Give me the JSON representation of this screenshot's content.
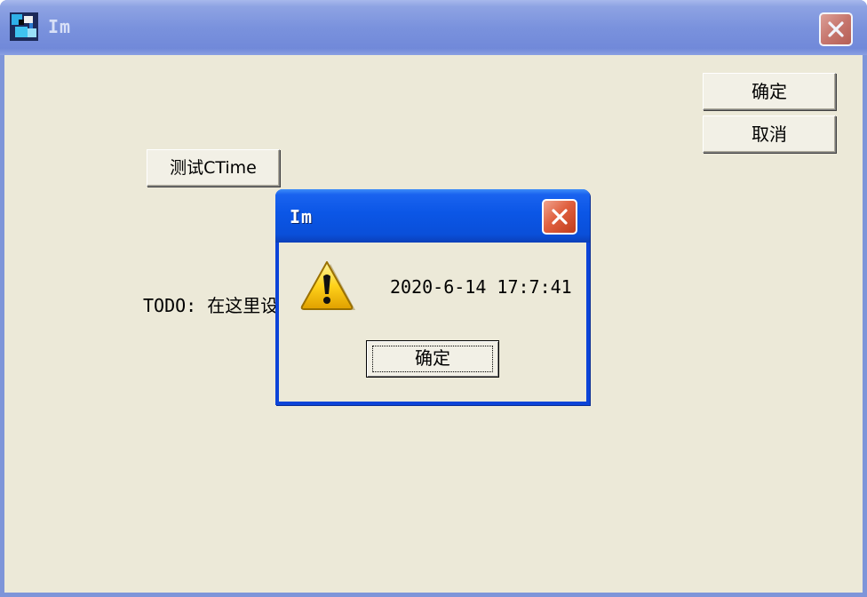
{
  "main_window": {
    "title": "Im",
    "app_icon": "app-icon",
    "close_icon": "close-icon",
    "ok_button": "确定",
    "cancel_button": "取消",
    "test_button": "测试CTime",
    "todo_text": "TODO: 在这里设"
  },
  "message_box": {
    "title": "Im",
    "close_icon": "close-icon",
    "icon": "warning-icon",
    "message": "2020-6-14 17:7:41",
    "ok_button": "确定"
  },
  "colors": {
    "inactive_titlebar": "#7a92dd",
    "active_titlebar": "#0b56e6",
    "close_button": "#e0603f",
    "window_face": "#ece9d8"
  }
}
